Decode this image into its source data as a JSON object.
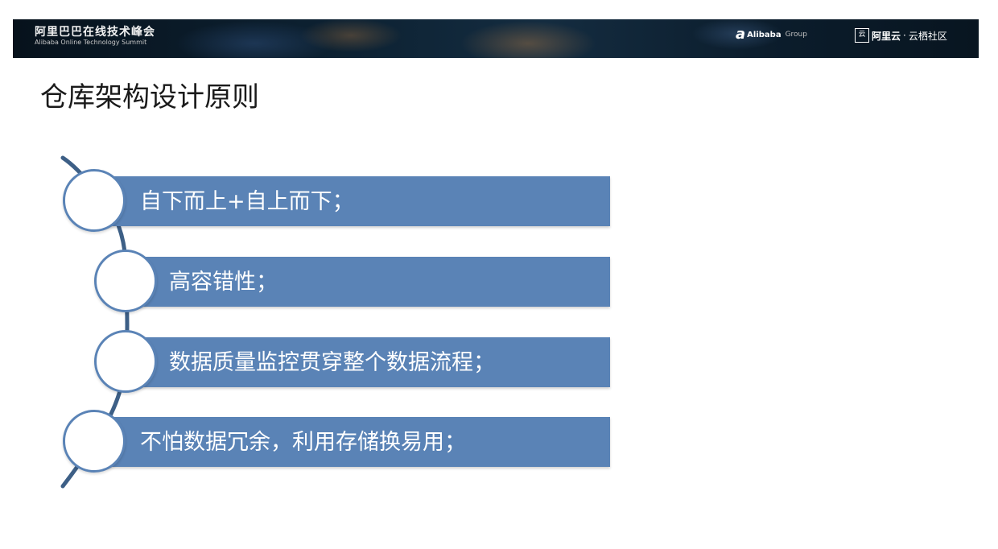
{
  "header": {
    "title": "阿里巴巴在线技术峰会",
    "subtitle": "Alibaba Online Technology Summit",
    "alibaba_logo": {
      "glyph": "a",
      "name": "Alibaba",
      "group": "Group"
    },
    "cloud_logo": {
      "box": "云",
      "name": "阿里云",
      "separator": "·",
      "community": "云栖社区"
    }
  },
  "slide": {
    "title": "仓库架构设计原则",
    "items": [
      {
        "label": "自下而上+自上而下；"
      },
      {
        "label": "高容错性；"
      },
      {
        "label": "数据质量监控贯穿整个数据流程；"
      },
      {
        "label": "不怕数据冗余，利用存储换易用；"
      }
    ]
  },
  "colors": {
    "bar": "#5a83b6",
    "connector": "#3d5f86",
    "banner": "#0d2233"
  }
}
